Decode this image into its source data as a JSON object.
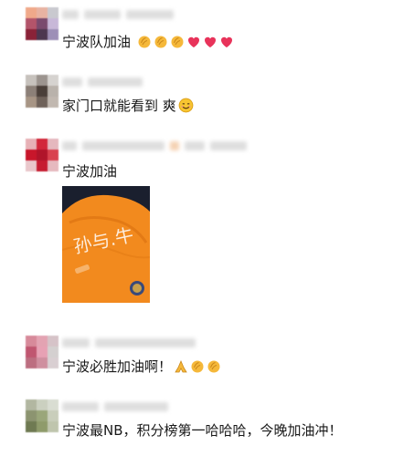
{
  "comments": [
    {
      "text": "宁波队加油",
      "emojis": [
        "clap-icon",
        "clap-icon",
        "clap-icon",
        "heart-icon",
        "heart-icon",
        "heart-icon"
      ]
    },
    {
      "text": "家门口就能看到 爽",
      "emojis": [
        "smile-icon"
      ]
    },
    {
      "text": "宁波加油",
      "emojis": [],
      "photo": "orange-jersey-photo"
    },
    {
      "text": "宁波必胜加油啊！",
      "emojis": [
        "pray-icon",
        "clap-icon",
        "clap-icon"
      ]
    },
    {
      "text": "宁波最NB，积分榜第一哈哈哈，今晚加油冲！",
      "emojis": []
    }
  ],
  "colors": {
    "text": "#191919",
    "heart": "#e8335a",
    "clap": "#f5b83a",
    "jersey": "#f28a1e"
  }
}
